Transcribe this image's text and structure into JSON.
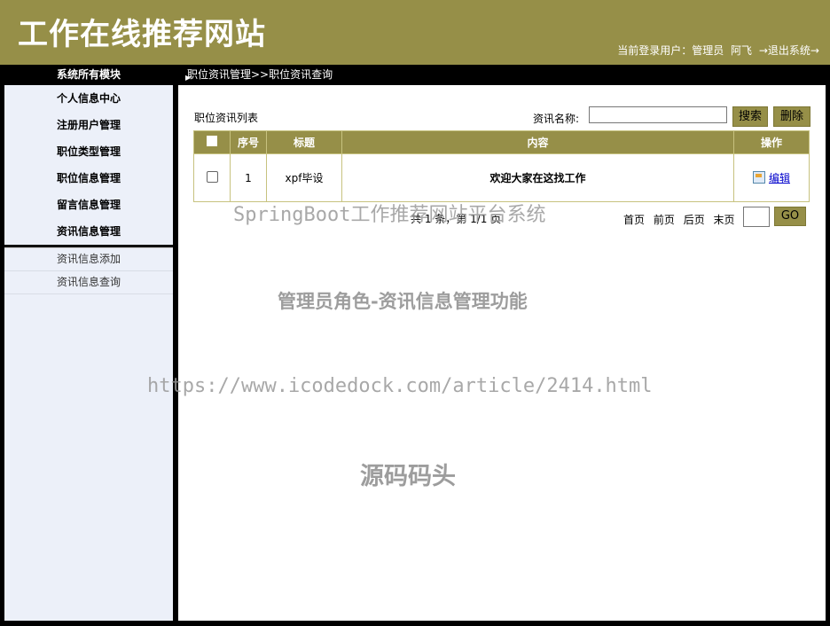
{
  "header": {
    "title": "工作在线推荐网站",
    "login_label": "当前登录用户：管理员",
    "username": "阿飞",
    "logout_label": "→退出系统→"
  },
  "topbar": {
    "module_title": "系统所有模块",
    "breadcrumb": "职位资讯管理>>职位资讯查询"
  },
  "sidebar": {
    "items": [
      {
        "label": "个人信息中心"
      },
      {
        "label": "注册用户管理"
      },
      {
        "label": "职位类型管理"
      },
      {
        "label": "职位信息管理"
      },
      {
        "label": "留言信息管理"
      },
      {
        "label": "资讯信息管理"
      }
    ],
    "submenu": [
      {
        "label": "资讯信息添加"
      },
      {
        "label": "资讯信息查询"
      }
    ]
  },
  "main": {
    "list_title": "职位资讯列表",
    "search_label": "资讯名称:",
    "search_value": "",
    "search_button": "搜索",
    "delete_button": "删除",
    "table": {
      "headers": [
        "",
        "序号",
        "标题",
        "内容",
        "操作"
      ],
      "rows": [
        {
          "index": "1",
          "title": "xpf毕设",
          "content": "欢迎大家在这找工作",
          "action": "编辑"
        }
      ]
    },
    "pager": {
      "info": "共 1 条，第 1/1 页",
      "first": "首页",
      "prev": "前页",
      "next": "后页",
      "last": "末页",
      "go_label": "GO"
    }
  },
  "watermarks": {
    "line1": "SpringBoot工作推荐网站平台系统",
    "line2": "管理员角色-资讯信息管理功能",
    "line3": "https://www.icodedock.com/article/2414.html",
    "line4": "源码码头"
  },
  "colors": {
    "accent": "#968f48",
    "sidebar_bg": "#ecf0f9"
  }
}
